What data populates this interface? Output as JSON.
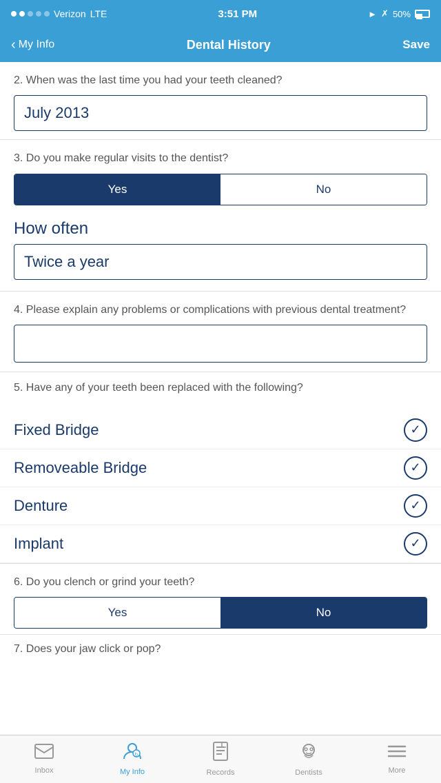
{
  "statusBar": {
    "carrier": "Verizon",
    "network": "LTE",
    "time": "3:51 PM",
    "battery": "50%"
  },
  "navBar": {
    "backLabel": "My Info",
    "title": "Dental History",
    "saveLabel": "Save"
  },
  "questions": {
    "q2": {
      "text": "2.  When was the last time you had your teeth cleaned?",
      "value": "July 2013"
    },
    "q3": {
      "text": "3.  Do you make regular visits to the dentist?",
      "yesLabel": "Yes",
      "noLabel": "No",
      "selected": "yes",
      "howOftenLabel": "How often",
      "howOftenValue": "Twice a year"
    },
    "q4": {
      "text": "4.  Please explain any problems or complications with previous dental treatment?",
      "value": ""
    },
    "q5": {
      "text": "5.  Have any of your teeth been replaced with the following?",
      "options": [
        {
          "label": "Fixed Bridge",
          "checked": true
        },
        {
          "label": "Removeable Bridge",
          "checked": true
        },
        {
          "label": "Denture",
          "checked": true
        },
        {
          "label": "Implant",
          "checked": true
        }
      ]
    },
    "q6": {
      "text": "6.  Do you clench or grind your teeth?",
      "yesLabel": "Yes",
      "noLabel": "No",
      "selected": "no"
    },
    "q7": {
      "partialText": "7.  Does your jaw click or pop?"
    }
  },
  "tabBar": {
    "tabs": [
      {
        "id": "inbox",
        "label": "Inbox",
        "icon": "✉",
        "active": false
      },
      {
        "id": "myinfo",
        "label": "My Info",
        "icon": "👤",
        "active": true
      },
      {
        "id": "records",
        "label": "Records",
        "icon": "📋",
        "active": false
      },
      {
        "id": "dentists",
        "label": "Dentists",
        "icon": "🏥",
        "active": false
      },
      {
        "id": "more",
        "label": "More",
        "icon": "☰",
        "active": false
      }
    ]
  }
}
